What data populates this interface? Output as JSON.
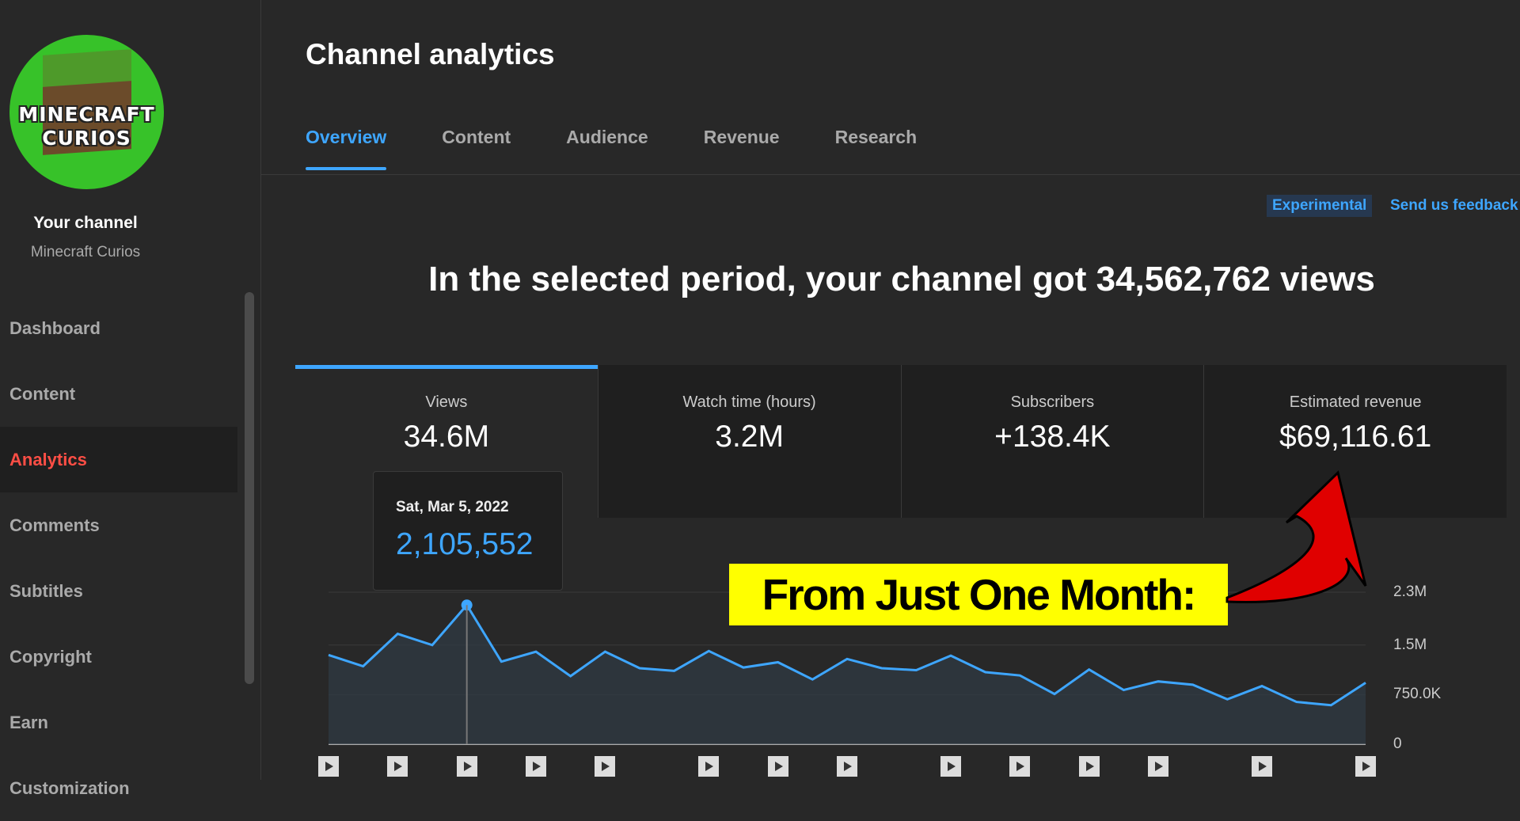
{
  "sidebar": {
    "avatar_text_line1": "MINECRAFT",
    "avatar_text_line2": "CURIOS",
    "your_channel": "Your channel",
    "channel_name": "Minecraft Curios",
    "items": [
      {
        "label": "Dashboard"
      },
      {
        "label": "Content"
      },
      {
        "label": "Analytics",
        "active": true
      },
      {
        "label": "Comments"
      },
      {
        "label": "Subtitles"
      },
      {
        "label": "Copyright"
      },
      {
        "label": "Earn"
      },
      {
        "label": "Customization"
      }
    ]
  },
  "header": {
    "title": "Channel analytics",
    "tabs": [
      {
        "label": "Overview",
        "active": true
      },
      {
        "label": "Content"
      },
      {
        "label": "Audience"
      },
      {
        "label": "Revenue"
      },
      {
        "label": "Research"
      }
    ],
    "experimental": "Experimental",
    "feedback": "Send us feedback"
  },
  "headline": "In the selected period, your channel got 34,562,762 views",
  "metrics": [
    {
      "label": "Views",
      "value": "34.6M",
      "selected": true
    },
    {
      "label": "Watch time (hours)",
      "value": "3.2M"
    },
    {
      "label": "Subscribers",
      "value": "+138.4K"
    },
    {
      "label": "Estimated revenue",
      "value": "$69,116.61"
    }
  ],
  "tooltip": {
    "date": "Sat, Mar 5, 2022",
    "value": "2,105,552"
  },
  "callout": "From Just One Month:",
  "colors": {
    "accent": "#3ea6ff",
    "active_nav": "#ff4e45",
    "callout_bg": "#ffff00",
    "arrow": "#e00000"
  },
  "chart_data": {
    "type": "line",
    "y_tick_labels": [
      "0",
      "750.0K",
      "1.5M",
      "2.3M"
    ],
    "ylim": [
      0,
      2300000
    ],
    "series": [
      {
        "values": [
          1350000,
          1180000,
          1670000,
          1500000,
          2105552,
          1250000,
          1400000,
          1030000,
          1400000,
          1150000,
          1110000,
          1410000,
          1160000,
          1240000,
          980000,
          1290000,
          1150000,
          1120000,
          1340000,
          1090000,
          1040000,
          760000,
          1130000,
          820000,
          950000,
          900000,
          680000,
          880000,
          640000,
          590000,
          930000
        ]
      }
    ],
    "highlight_index": 4,
    "video_marker_indices": [
      0,
      2,
      4,
      6,
      8,
      11,
      13,
      15,
      18,
      20,
      22,
      24,
      27,
      30
    ]
  }
}
